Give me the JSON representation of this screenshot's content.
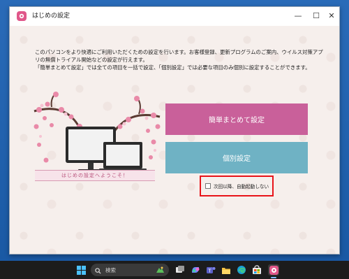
{
  "window": {
    "title": "はじめの設定",
    "minimize_glyph": "—",
    "maximize_glyph": "☐",
    "close_glyph": "✕"
  },
  "description": {
    "line1": "このパソコンをより快適にご利用いただくための設定を行います。お客様登録、更新プログラムのご案内、ウイルス対策アプ",
    "line2": "リの無償トライアル開始などの設定が行えます。",
    "line3": "「簡単まとめて設定」では全ての項目を一括で設定、「個別設定」では必要な項目のみ個別に設定することができます。"
  },
  "illustration": {
    "banner_text": "はじめの設定へようこそ！"
  },
  "buttons": {
    "main": "簡単まとめて設定",
    "individual": "個別設定"
  },
  "checkbox": {
    "label": "次回以降、自動起動しない",
    "checked": false
  },
  "taskbar": {
    "search_placeholder": "検索",
    "icons": [
      "windows-start-icon",
      "search-icon",
      "widgets-icon",
      "task-view-icon",
      "copilot-icon",
      "teams-icon",
      "file-explorer-icon",
      "edge-icon",
      "store-icon",
      "setup-app-icon"
    ]
  },
  "colors": {
    "desktop": "#1f5fa8",
    "main_button": "#c9609a",
    "individual_button": "#6fb2c4",
    "highlight": "#e8141a",
    "content_bg": "#f6efec"
  }
}
